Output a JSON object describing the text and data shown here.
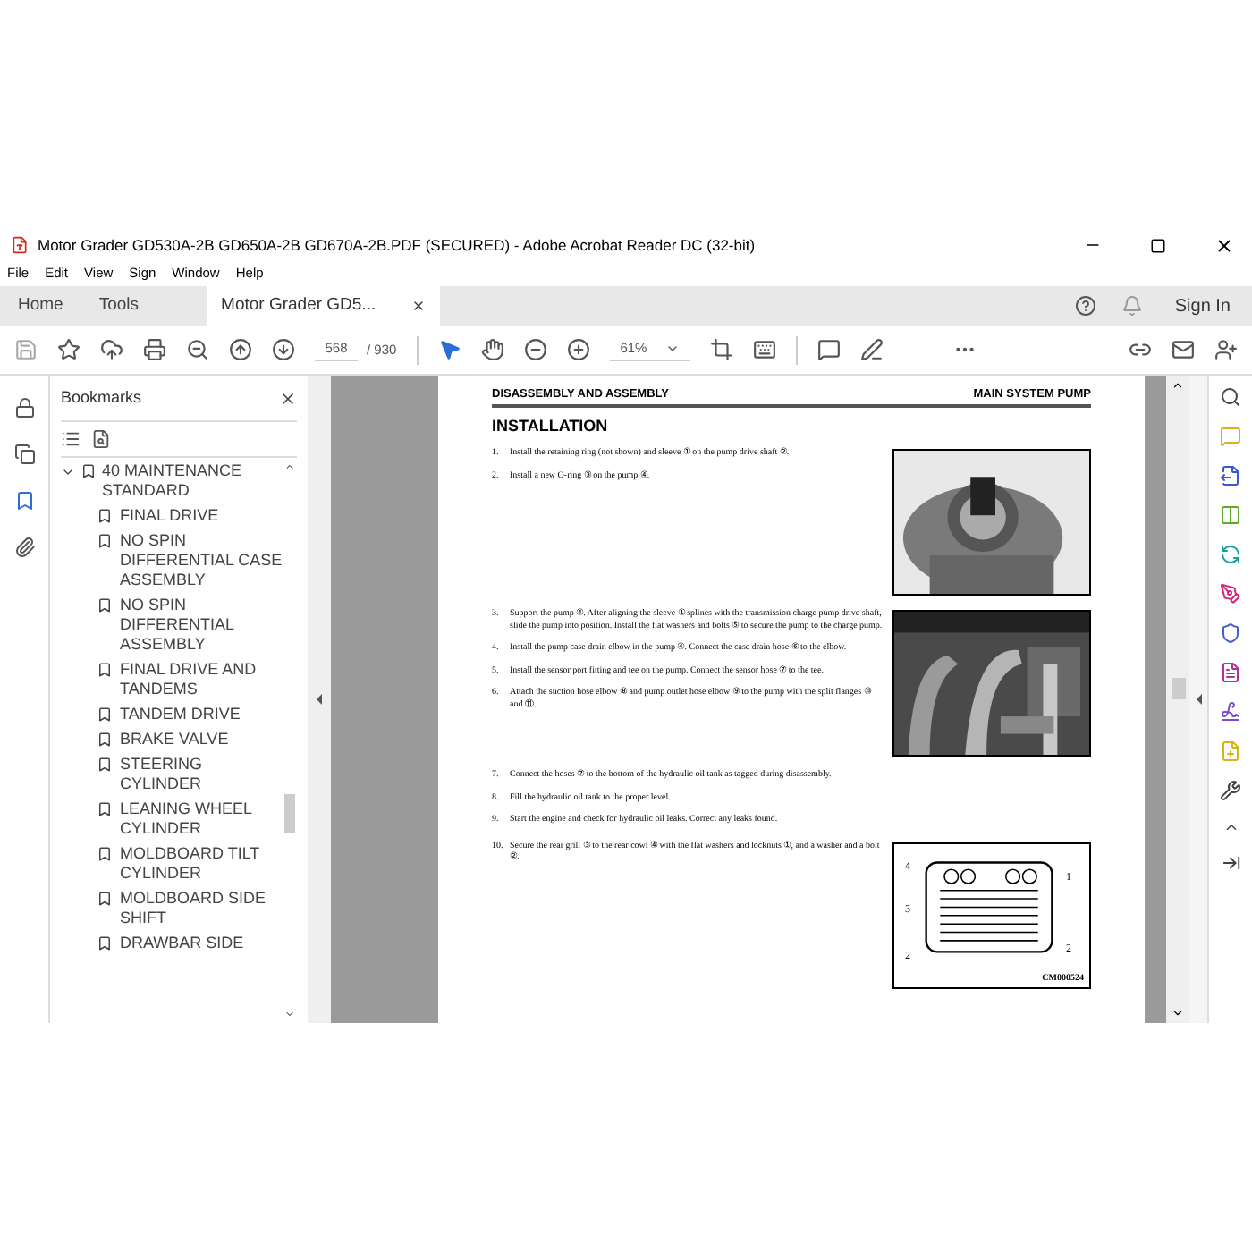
{
  "window": {
    "title": "Motor Grader GD530A-2B GD650A-2B GD670A-2B.PDF (SECURED) - Adobe Acrobat Reader DC (32-bit)"
  },
  "menu": [
    "File",
    "Edit",
    "View",
    "Sign",
    "Window",
    "Help"
  ],
  "tabs": [
    {
      "label": "Home",
      "selected": false
    },
    {
      "label": "Tools",
      "selected": false
    },
    {
      "label": "Motor Grader GD5...",
      "selected": true,
      "closable": true
    }
  ],
  "sign_in": "Sign In",
  "toolbar": {
    "page": "568",
    "page_total": "/ 930",
    "zoom": "61%"
  },
  "bookmarks": {
    "title": "Bookmarks",
    "items": [
      {
        "label": "40 MAINTENANCE STANDARD",
        "expanded": true,
        "children": [
          {
            "label": "FINAL DRIVE"
          },
          {
            "label": "NO SPIN DIFFERENTIAL CASE ASSEMBLY"
          },
          {
            "label": "NO SPIN DIFFERENTIAL ASSEMBLY"
          },
          {
            "label": "FINAL DRIVE AND TANDEMS"
          },
          {
            "label": "TANDEM DRIVE"
          },
          {
            "label": "BRAKE VALVE"
          },
          {
            "label": "STEERING CYLINDER"
          },
          {
            "label": "LEANING WHEEL CYLINDER"
          },
          {
            "label": "MOLDBOARD TILT CYLINDER"
          },
          {
            "label": "MOLDBOARD SIDE SHIFT"
          },
          {
            "label": "DRAWBAR SIDE"
          }
        ]
      }
    ]
  },
  "page": {
    "header_left": "DISASSEMBLY AND ASSEMBLY",
    "header_right": "MAIN SYSTEM PUMP",
    "heading": "INSTALLATION",
    "sections": [
      {
        "steps": [
          {
            "number": "1.",
            "text": "Install the retaining ring (not shown) and sleeve ① on the pump drive shaft ②."
          },
          {
            "number": "2.",
            "text": "Install a new O-ring ③ on the pump ④."
          }
        ],
        "figure": {
          "kind": "picture"
        }
      },
      {
        "steps": [
          {
            "number": "3.",
            "text": "Support the pump ④. After aligning the sleeve ① splines with the transmission charge pump drive shaft, slide the pump into position. Install the flat washers and bolts ⑤ to secure the pump to the charge pump."
          },
          {
            "number": "4.",
            "text": "Install the pump case drain elbow in the pump ④. Connect the case drain hose ⑥ to the elbow."
          },
          {
            "number": "5.",
            "text": "Install the sensor port fitting and tee on the pump. Connect the sensor hose ⑦ to the tee."
          },
          {
            "number": "6.",
            "text": "Attach the suction hose elbow ⑧ and pump outlet hose elbow ⑨ to the pump with the split flanges ⑩ and ⑪."
          }
        ],
        "figure": {
          "kind": "picture"
        }
      },
      {
        "steps": [
          {
            "number": "7.",
            "text": "Connect the hoses ⑦ to the bottom of the hydraulic oil tank as tagged during disassembly."
          },
          {
            "number": "8.",
            "text": "Fill the hydraulic oil tank to the proper level."
          },
          {
            "number": "9.",
            "text": "Start the engine and check for hydraulic oil leaks. Correct any leaks found."
          }
        ]
      },
      {
        "steps": [
          {
            "number": "10.",
            "text": "Secure the rear grill ③ to the rear cowl ④ with the flat washers and locknuts ①, and a washer and a bolt ②."
          }
        ],
        "figure": {
          "kind": "drawing",
          "labels": [
            "4",
            "1",
            "3",
            "2",
            "2"
          ],
          "code": "CM000524"
        }
      }
    ]
  }
}
